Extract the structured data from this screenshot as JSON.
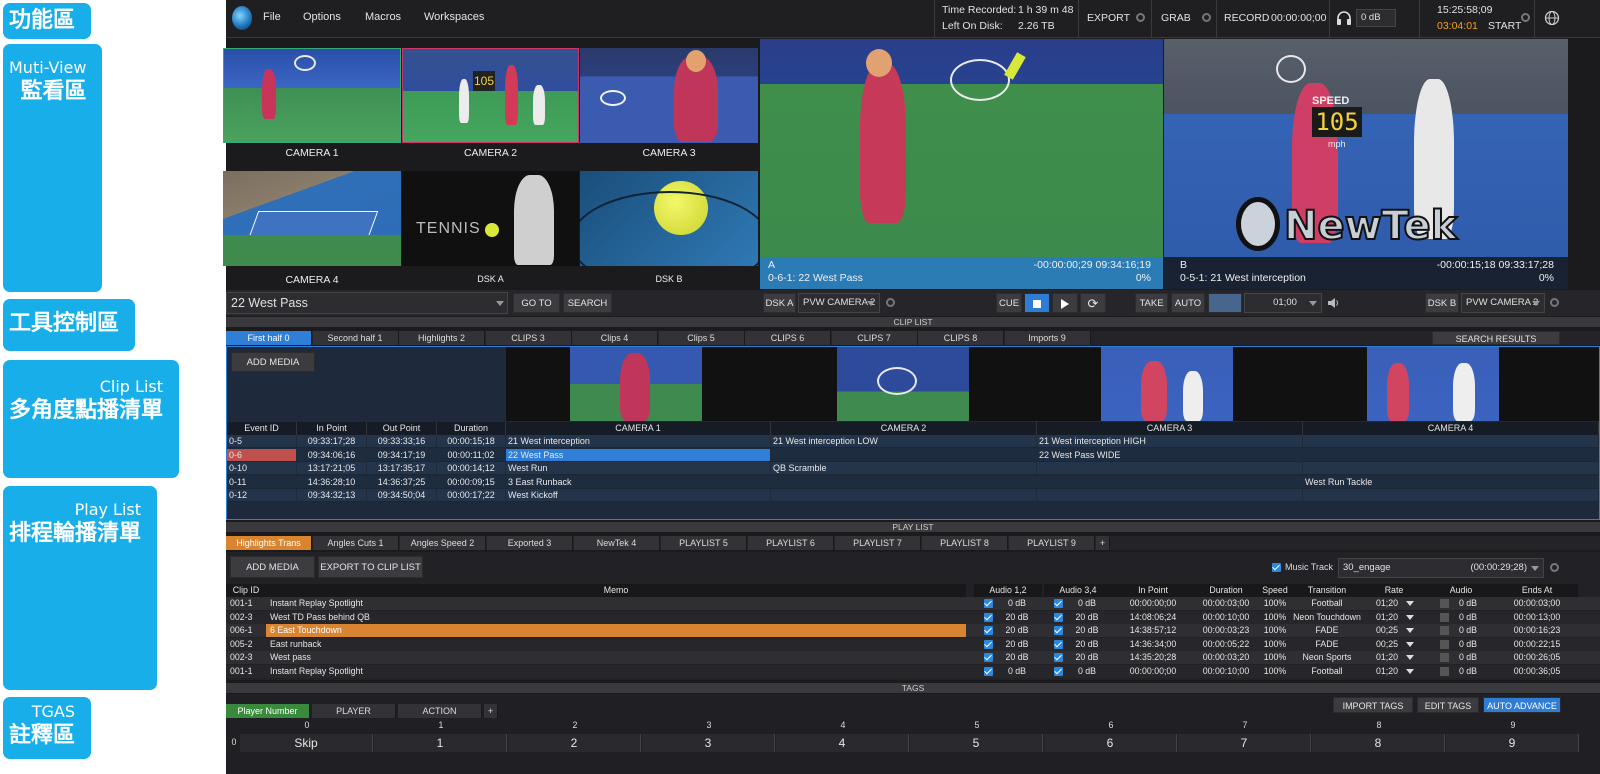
{
  "legend": [
    {
      "en": "",
      "zh": "功能區"
    },
    {
      "en": "Muti-View",
      "zh": "監看區"
    },
    {
      "en": "",
      "zh": "工具控制區"
    },
    {
      "en": "Clip List",
      "zh": "多角度點播清單"
    },
    {
      "en": "Play List",
      "zh": "排程輪播清單"
    },
    {
      "en": "TGAS",
      "zh": "註釋區"
    }
  ],
  "menu": {
    "file": "File",
    "options": "Options",
    "macros": "Macros",
    "workspaces": "Workspaces"
  },
  "status": {
    "time_recorded_label": "Time Recorded:",
    "time_recorded": "1 h 39 m 48",
    "left_on_disk_label": "Left On Disk:",
    "left_on_disk": "2.26 TB",
    "export": "EXPORT",
    "grab": "GRAB",
    "record": "RECORD",
    "record_time": "00:00:00;00",
    "audio_level": "0 dB",
    "clock": "15:25:58;09",
    "start_time": "03:04:01",
    "start": "START"
  },
  "multiview": [
    {
      "label": "CAMERA 1"
    },
    {
      "label": "CAMERA 2"
    },
    {
      "label": "CAMERA 3"
    },
    {
      "label": "CAMERA 4"
    },
    {
      "label": "DSK A",
      "text": "TENNIS"
    },
    {
      "label": "DSK B"
    }
  ],
  "program": {
    "letter": "A",
    "clip": "0-6-1: 22 West Pass",
    "timecode": "-00:00:00;29  09:34:16;19",
    "percent": "0%"
  },
  "preview": {
    "letter": "B",
    "clip": "0-5-1: 21 West interception",
    "timecode": "-00:00:15;18  09:33:17;28",
    "percent": "0%",
    "speed_text": "SPEED",
    "speed_value": "105",
    "speed_unit": "mph",
    "logo": "NewTek"
  },
  "toolbar": {
    "clip_name": "22 West Pass",
    "goto": "GO TO",
    "search": "SEARCH",
    "dsk_a": "DSK A",
    "dsk_a_source": "PVW CAMERA 2",
    "cue": "CUE",
    "take": "TAKE",
    "auto": "AUTO",
    "duration": "01;00",
    "dsk_b": "DSK B",
    "dsk_b_source": "PVW CAMERA 2"
  },
  "clip_list": {
    "title": "CLIP LIST",
    "tabs": [
      "First half 0",
      "Second half 1",
      "Highlights 2",
      "CLIPS 3",
      "Clips 4",
      "Clips 5",
      "CLIPS 6",
      "CLIPS 7",
      "CLIPS 8",
      "Imports 9"
    ],
    "search_results": "SEARCH RESULTS",
    "add_media": "ADD MEDIA",
    "columns": [
      "Event ID",
      "In Point",
      "Out Point",
      "Duration",
      "CAMERA 1",
      "CAMERA 2",
      "CAMERA 3",
      "CAMERA 4"
    ],
    "rows": [
      [
        "0-5",
        "09:33:17;28",
        "09:33:33;16",
        "00:00:15;18",
        "21 West interception",
        "21 West interception LOW",
        "21 West interception HIGH",
        ""
      ],
      [
        "0-6",
        "09:34:06;16",
        "09:34:17;19",
        "00:00:11;02",
        "22 West Pass",
        "",
        "22 West Pass WIDE",
        ""
      ],
      [
        "0-10",
        "13:17:21;05",
        "13:17:35;17",
        "00:00:14;12",
        "West Run",
        "QB Scramble",
        "",
        ""
      ],
      [
        "0-11",
        "14:36:28;10",
        "14:36:37;25",
        "00:00:09;15",
        "3 East Runback",
        "",
        "",
        "West Run Tackle"
      ],
      [
        "0-12",
        "09:34:32;13",
        "09:34:50;04",
        "00:00:17;22",
        "West Kickoff",
        "",
        "",
        ""
      ]
    ]
  },
  "play_list": {
    "title": "PLAY LIST",
    "tabs": [
      "Highlights Trans",
      "Angles Cuts 1",
      "Angles Speed 2",
      "Exported 3",
      "NewTek 4",
      "PLAYLIST 5",
      "PLAYLIST 6",
      "PLAYLIST 7",
      "PLAYLIST 8",
      "PLAYLIST 9"
    ],
    "plus": "+",
    "add_media": "ADD MEDIA",
    "export_to_clip_list": "EXPORT TO CLIP LIST",
    "music_track_label": "Music Track",
    "music_track": "30_engage",
    "music_duration": "(00:00:29;28)",
    "columns": [
      "Clip ID",
      "Memo",
      "Audio 1,2",
      "Audio 3,4",
      "In Point",
      "Duration",
      "Speed",
      "Transition",
      "Rate",
      "Audio",
      "Ends At"
    ],
    "rows": [
      [
        "001-1",
        "Instant Replay Spotlight",
        "0 dB",
        "0 dB",
        "00:00:00;00",
        "00:00:03;00",
        "100%",
        "Football",
        "01;20",
        "0 dB",
        "00:00:03;00"
      ],
      [
        "002-3",
        "West TD Pass behind QB",
        "20 dB",
        "20 dB",
        "14:08:06;24",
        "00:00:10;00",
        "100%",
        "Neon Touchdown",
        "01;20",
        "0 dB",
        "00:00:13;00"
      ],
      [
        "006-1",
        "6 East Touchdown",
        "20 dB",
        "20 dB",
        "14:38:57;12",
        "00:00:03;23",
        "100%",
        "FADE",
        "00;25",
        "0 dB",
        "00:00:16;23"
      ],
      [
        "005-2",
        "East runback",
        "20 dB",
        "20 dB",
        "14:36:34;00",
        "00:00:05;22",
        "100%",
        "FADE",
        "00;25",
        "0 dB",
        "00:00:22;15"
      ],
      [
        "002-3",
        "West pass",
        "20 dB",
        "20 dB",
        "14:35:20;28",
        "00:00:03;20",
        "100%",
        "Neon Sports",
        "01;20",
        "0 dB",
        "00:00:26;05"
      ],
      [
        "001-1",
        "Instant Replay Spotlight",
        "0 dB",
        "0 dB",
        "00:00:00;00",
        "00:00:10;00",
        "100%",
        "Football",
        "01;20",
        "0 dB",
        "00:00:36;05"
      ]
    ]
  },
  "tags": {
    "title": "TAGS",
    "tabs": [
      "Player Number",
      "PLAYER",
      "ACTION"
    ],
    "plus": "+",
    "import_tags": "IMPORT TAGS",
    "edit_tags": "EDIT TAGS",
    "auto_advance": "AUTO ADVANCE",
    "header": [
      "0",
      "1",
      "2",
      "3",
      "4",
      "5",
      "6",
      "7",
      "8",
      "9"
    ],
    "row_index": "0",
    "cells": [
      "Skip",
      "1",
      "2",
      "3",
      "4",
      "5",
      "6",
      "7",
      "8",
      "9"
    ]
  },
  "colors": {
    "accent_blue": "#2f7ed8",
    "legend_blue": "#17aee9",
    "highlight_orange": "#d88431",
    "event_red": "#c0504d"
  }
}
